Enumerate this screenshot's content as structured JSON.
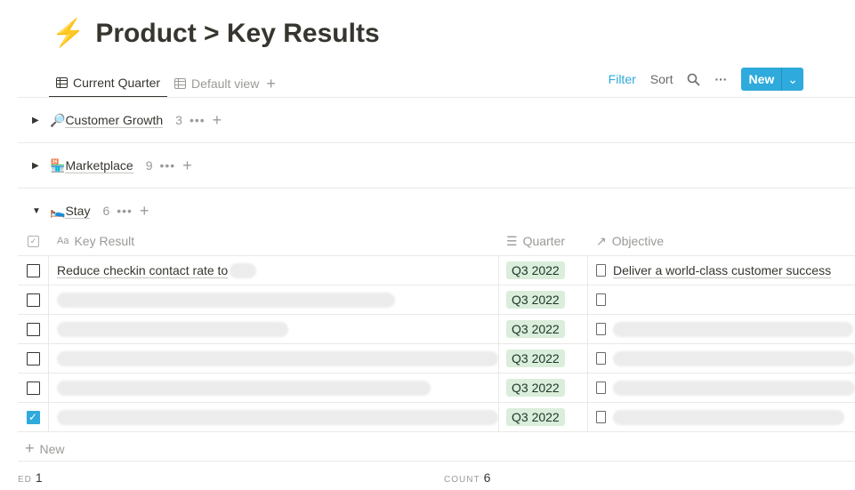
{
  "page": {
    "icon": "⚡",
    "title": "Product > Key Results"
  },
  "tabs": [
    {
      "label": "Current Quarter",
      "active": true
    },
    {
      "label": "Default view",
      "active": false
    }
  ],
  "toolbar": {
    "filter": "Filter",
    "sort": "Sort",
    "new": "New"
  },
  "groups": [
    {
      "icon": "🔎",
      "name": "Customer Growth",
      "count": "3",
      "expanded": false
    },
    {
      "icon": "🏪",
      "name": "Marketplace",
      "count": "9",
      "expanded": false
    },
    {
      "icon": "🛌",
      "name": "Stay",
      "count": "6",
      "expanded": true
    }
  ],
  "table": {
    "columns": [
      "Key Result",
      "Quarter",
      "Objective"
    ],
    "rows": [
      {
        "done": false,
        "key_result": "Reduce checkin contact rate to",
        "quarter": "Q3 2022",
        "objective": "Deliver a world-class customer success"
      },
      {
        "done": false,
        "key_result": "",
        "quarter": "Q3 2022",
        "objective": ""
      },
      {
        "done": false,
        "key_result": "",
        "quarter": "Q3 2022",
        "objective": ""
      },
      {
        "done": false,
        "key_result": "",
        "quarter": "Q3 2022",
        "objective": ""
      },
      {
        "done": false,
        "key_result": "",
        "quarter": "Q3 2022",
        "objective": ""
      },
      {
        "done": true,
        "key_result": "",
        "quarter": "Q3 2022",
        "objective": ""
      }
    ],
    "new_label": "New"
  },
  "footer": {
    "checked_label": "ED",
    "checked_value": "1",
    "count_label": "COUNT",
    "count_value": "6"
  },
  "colors": {
    "accent": "#2eaadc",
    "tag_bg": "#dbeddb"
  }
}
